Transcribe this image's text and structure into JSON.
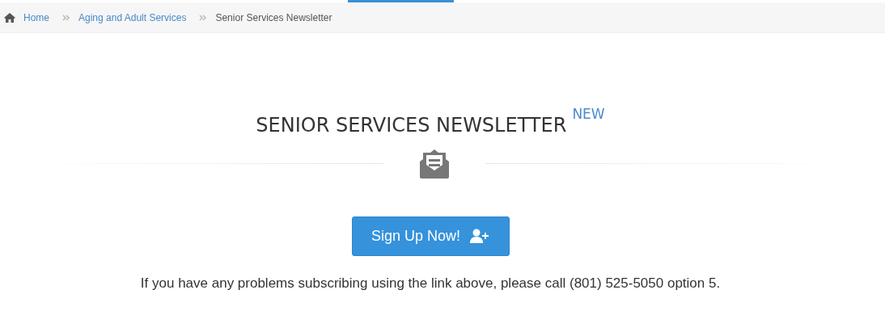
{
  "breadcrumb": [
    {
      "label": "Home",
      "kind": "link"
    },
    {
      "label": "Aging and Adult Services",
      "kind": "link"
    },
    {
      "label": "Senior Services Newsletter",
      "kind": "current"
    }
  ],
  "heading": {
    "title": "SENIOR SERVICES NEWSLETTER",
    "badge": "NEW"
  },
  "signup_button": {
    "label": "Sign Up Now!"
  },
  "note": "If you have any problems subscribing using the link above, please call (801) 525-5050 option 5."
}
